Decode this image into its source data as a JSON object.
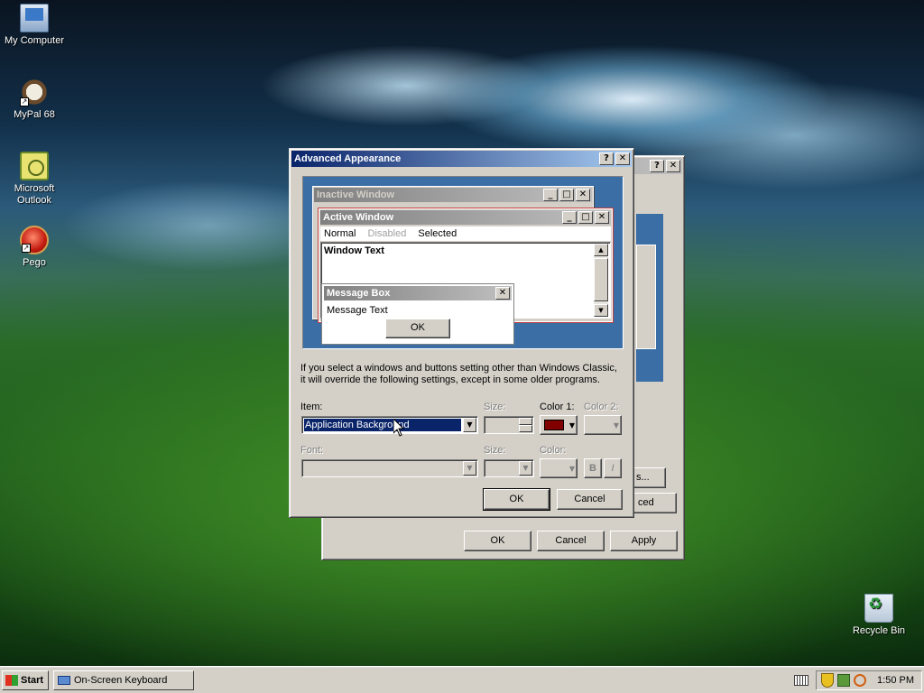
{
  "desktop": {
    "icons": [
      {
        "label": "My Computer",
        "icon": "computer-icon"
      },
      {
        "label": "MyPal 68",
        "icon": "mypal-browser-icon"
      },
      {
        "label": "Microsoft Outlook",
        "icon": "outlook-icon"
      },
      {
        "label": "Pego",
        "icon": "pego-icon"
      },
      {
        "label": "Recycle Bin",
        "icon": "recycle-bin-icon"
      }
    ]
  },
  "back_window": {
    "buttons": {
      "ok": "OK",
      "cancel": "Cancel",
      "apply": "Apply"
    },
    "partial_buttons": {
      "effects_tail": "s...",
      "advanced_tail": "ced"
    },
    "title_buttons": {
      "help": "?",
      "close": "✕"
    }
  },
  "dialog": {
    "title": "Advanced Appearance",
    "title_buttons": {
      "help": "?",
      "close": "✕"
    },
    "preview": {
      "inactive_title": "Inactive Window",
      "active_title": "Active Window",
      "menu": {
        "normal": "Normal",
        "disabled": "Disabled",
        "selected": "Selected"
      },
      "window_text": "Window Text",
      "message_box_title": "Message Box",
      "message_text": "Message Text",
      "ok_label": "OK",
      "window_buttons": {
        "minimize": "_",
        "maximize": "□",
        "close": "✕"
      }
    },
    "info_text_line1": "If you select a windows and buttons setting other than Windows Classic,",
    "info_text_line2": "it will override the following settings, except in some older programs.",
    "item": {
      "label": "Item:",
      "value": "Application Background"
    },
    "size1": {
      "label": "Size:"
    },
    "color1": {
      "label": "Color 1:",
      "value": "#800000"
    },
    "color2": {
      "label": "Color 2:"
    },
    "font": {
      "label": "Font:"
    },
    "size2": {
      "label": "Size:"
    },
    "color3": {
      "label": "Color:"
    },
    "bold_label": "B",
    "italic_label": "I",
    "ok_label": "OK",
    "cancel_label": "Cancel"
  },
  "taskbar": {
    "start_label": "Start",
    "task_label": "On-Screen Keyboard",
    "clock": "1:50 PM"
  },
  "colors": {
    "active_title": "#0a246a",
    "desktop_preview": "#3a6ea5",
    "selection": "#0a246a"
  }
}
